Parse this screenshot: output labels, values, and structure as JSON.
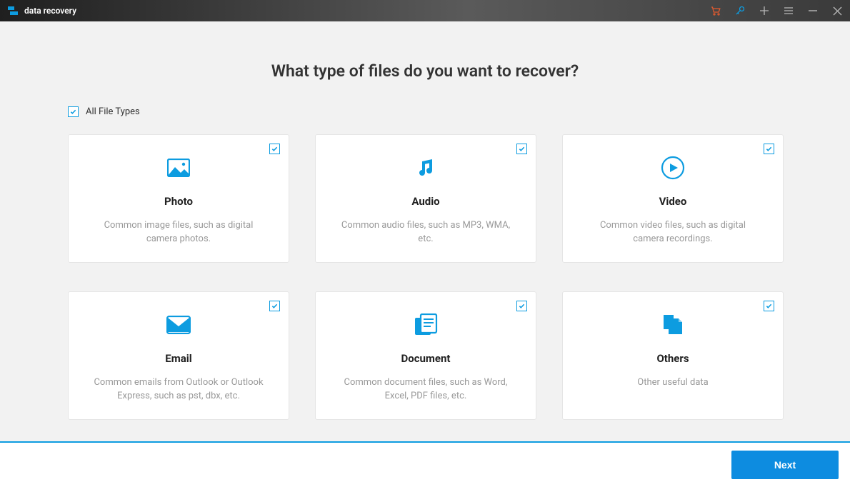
{
  "header": {
    "title": "data recovery"
  },
  "colors": {
    "accent": "#0d9ce0",
    "cart": "#e05a2f"
  },
  "main": {
    "heading": "What type of files do you want to recover?",
    "all_label": "All File Types",
    "all_checked": true
  },
  "cards": [
    {
      "key": "photo",
      "title": "Photo",
      "desc": "Common image files, such as digital camera photos.",
      "checked": true,
      "icon": "photo-icon"
    },
    {
      "key": "audio",
      "title": "Audio",
      "desc": "Common audio files, such as MP3, WMA, etc.",
      "checked": true,
      "icon": "audio-icon"
    },
    {
      "key": "video",
      "title": "Video",
      "desc": "Common video files, such as digital camera recordings.",
      "checked": true,
      "icon": "video-icon"
    },
    {
      "key": "email",
      "title": "Email",
      "desc": "Common emails from Outlook or Outlook Express, such as pst, dbx, etc.",
      "checked": true,
      "icon": "email-icon"
    },
    {
      "key": "document",
      "title": "Document",
      "desc": "Common document files, such as Word, Excel, PDF files, etc.",
      "checked": true,
      "icon": "document-icon"
    },
    {
      "key": "others",
      "title": "Others",
      "desc": "Other useful data",
      "checked": true,
      "icon": "files-icon"
    }
  ],
  "footer": {
    "next_label": "Next"
  }
}
